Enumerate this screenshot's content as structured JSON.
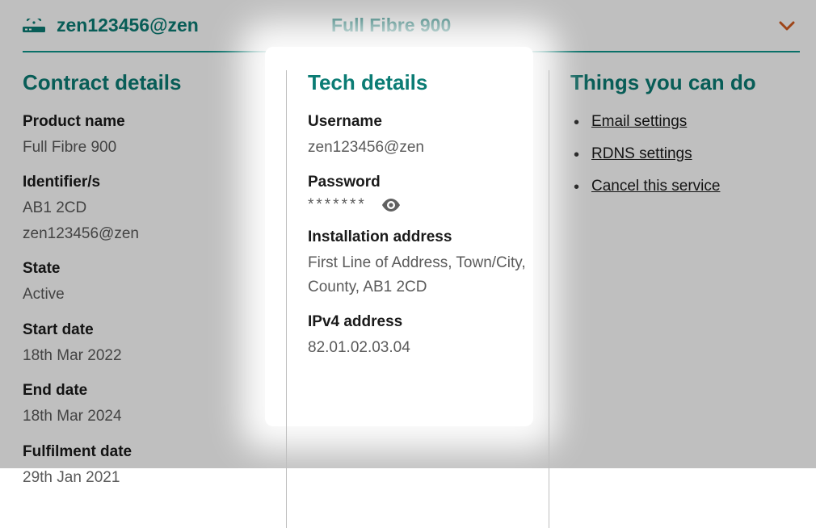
{
  "header": {
    "account": "zen123456@zen",
    "plan": "Full Fibre 900"
  },
  "contract": {
    "title": "Contract details",
    "product_label": "Product name",
    "product_value": "Full Fibre 900",
    "identifier_label": "Identifier/s",
    "identifier_value1": "AB1 2CD",
    "identifier_value2": "zen123456@zen",
    "state_label": "State",
    "state_value": "Active",
    "start_label": "Start date",
    "start_value": "18th Mar 2022",
    "end_label": "End date",
    "end_value": "18th Mar 2024",
    "fulfilment_label": "Fulfilment date",
    "fulfilment_value": "29th Jan 2021"
  },
  "tech": {
    "title": "Tech details",
    "username_label": "Username",
    "username_value": "zen123456@zen",
    "password_label": "Password",
    "password_mask": "*******",
    "address_label": "Installation address",
    "address_value": "First Line of Address, Town/City, County, AB1 2CD",
    "ipv4_label": "IPv4 address",
    "ipv4_value": "82.01.02.03.04"
  },
  "actions": {
    "title": "Things you can do",
    "items": [
      {
        "label": "Email settings"
      },
      {
        "label": "RDNS settings"
      },
      {
        "label": "Cancel this service"
      }
    ]
  }
}
